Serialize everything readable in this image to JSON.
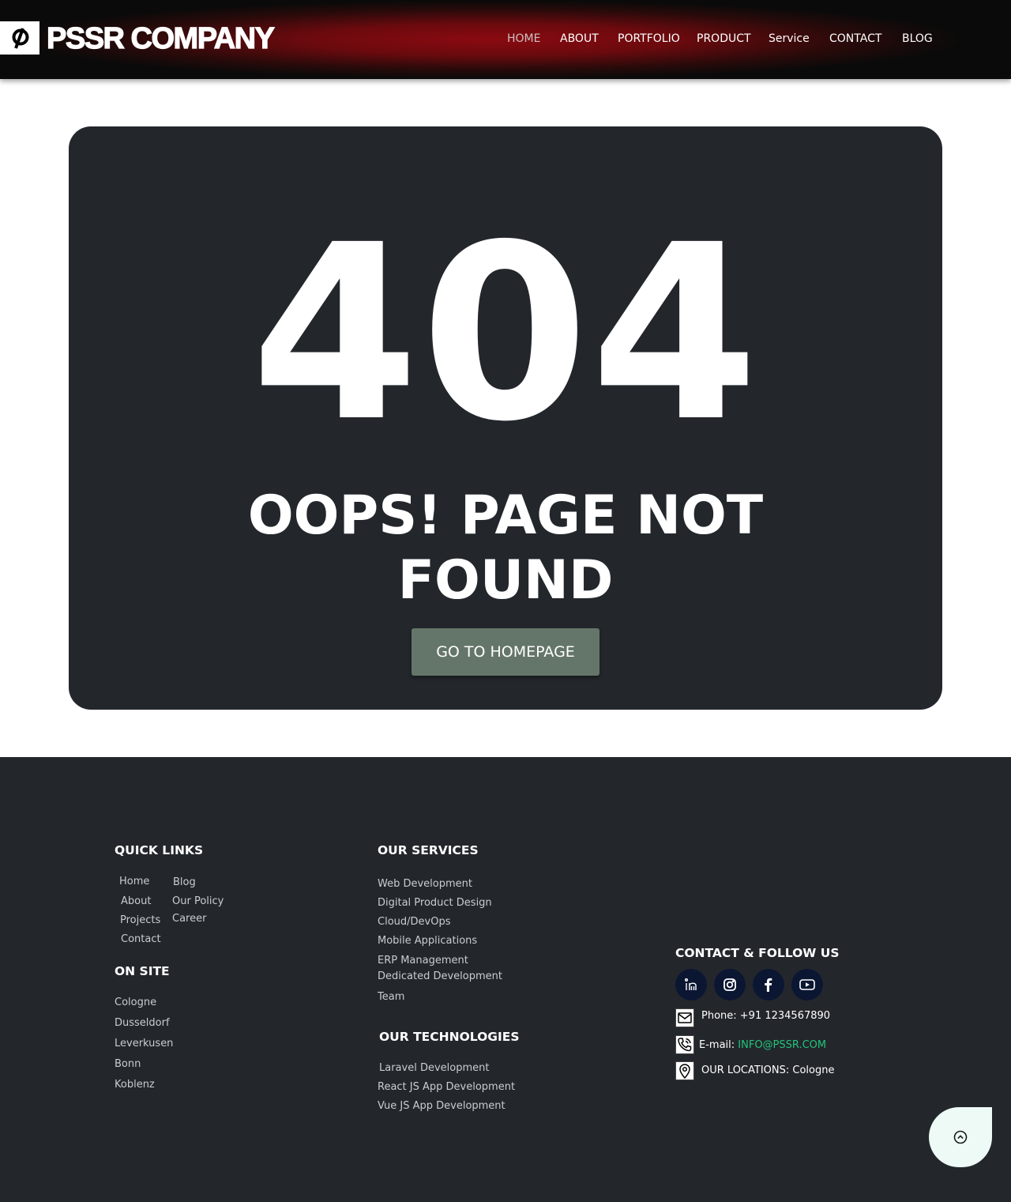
{
  "header": {
    "brand": "PSSR COMPANY",
    "logo_icon": "peloton-p-icon",
    "nav": {
      "home": "HOME",
      "about": "ABOUT",
      "portfolio": "PORTFOLIO",
      "product": "PRODUCT",
      "service": "Service",
      "contact": "CONTACT",
      "blog": "BLOG"
    },
    "active_color": "#c9c2c2",
    "accent": "#8a0a10"
  },
  "error": {
    "code": "404",
    "message": "OOPS! PAGE NOT FOUND",
    "button_label": "GO TO HOMEPAGE",
    "button_color": "#647669"
  },
  "footer": {
    "quick_links": {
      "heading": "QUICK LINKS",
      "col1": [
        "Home",
        "About",
        "Projects",
        "Contact"
      ],
      "col2": [
        "Blog",
        "Our Policy",
        "Career"
      ]
    },
    "on_site": {
      "heading": "ON SITE",
      "items": [
        "Cologne",
        "Dusseldorf",
        "Leverkusen",
        "Bonn",
        "Koblenz"
      ]
    },
    "services": {
      "heading": "OUR SERVICES",
      "items": [
        "Web Development",
        "Digital Product Design",
        "Cloud/DevOps",
        "Mobile Applications",
        "ERP Management",
        "Dedicated Development",
        "Team"
      ]
    },
    "technologies": {
      "heading": "OUR TECHNOLOGIES",
      "items": [
        "Laravel Development",
        "React JS App Development",
        "Vue JS App Development"
      ]
    },
    "contact": {
      "heading": "CONTACT & FOLLOW US",
      "social_icons": [
        "linkedin-icon",
        "instagram-icon",
        "facebook-icon",
        "youtube-icon"
      ],
      "phone": "Phone: +91 1234567890",
      "email_label": "E-mail: ",
      "email": "INFO@PSSR.COM",
      "location": "OUR LOCATIONS: Cologne",
      "email_color": "#22c47a"
    },
    "scroll_top_icon": "chevron-up-circle-icon"
  }
}
